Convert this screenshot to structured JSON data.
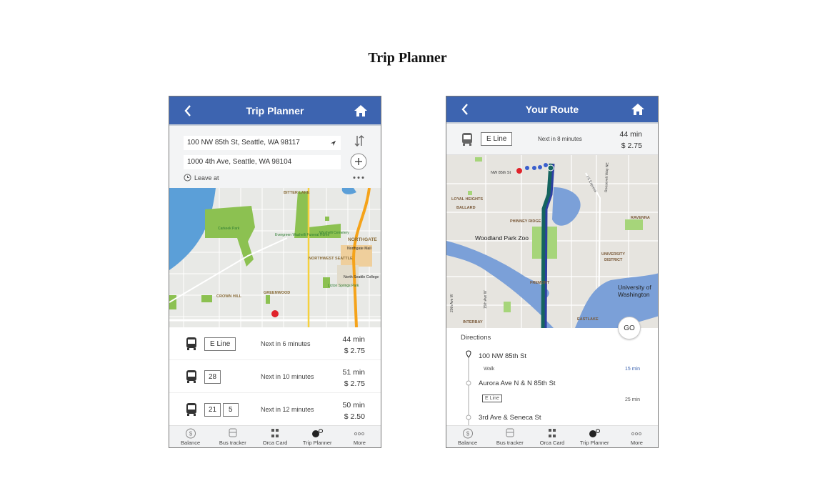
{
  "page_title": "Trip Planner",
  "colors": {
    "header": "#3d64b0",
    "route": "#15645f",
    "walk": "#3a5fcd",
    "origin_pin": "#e0232b"
  },
  "left": {
    "header": {
      "title": "Trip Planner",
      "back_icon": "chevron-left-icon",
      "home_icon": "home-icon"
    },
    "from": "100 NW 85th St, Seattle, WA 98117",
    "to": "1000 4th Ave, Seattle, WA 98104",
    "leave_at": "Leave at",
    "map_labels": [
      "BITTER LAKE",
      "Carkeek Park",
      "Evergreen Washelli Funeral Home",
      "Washelli Cemetery",
      "Northgate Mall",
      "NORTHGATE",
      "NORTHWEST SEATTLE",
      "North Seattle College",
      "Licton Springs Park",
      "GREENWOOD",
      "CROWN HILL"
    ],
    "results": [
      {
        "routes": [
          "E Line"
        ],
        "next": "Next in 6 minutes",
        "duration": "44 min",
        "fare": "$ 2.75"
      },
      {
        "routes": [
          "28"
        ],
        "next": "Next in 10 minutes",
        "duration": "51 min",
        "fare": "$ 2.75"
      },
      {
        "routes": [
          "21",
          "5"
        ],
        "next": "Next in 12 minutes",
        "duration": "50 min",
        "fare": "$ 2.50"
      }
    ]
  },
  "right": {
    "header": {
      "title": "Your Route"
    },
    "summary": {
      "route": "E Line",
      "next": "Next in 8 minutes",
      "duration": "44 min",
      "fare": "$ 2.75"
    },
    "map_labels": [
      "NW 85th St",
      "LOYAL HEIGHTS",
      "BALLARD",
      "PHINNEY RIDGE",
      "Woodland Park Zoo",
      "UNIVERSITY",
      "DISTRICT",
      "FREMONT",
      "University of",
      "Washington",
      "EASTLAKE",
      "INTERBAY",
      "RAVENNA",
      "I-5 Express",
      "Roosevelt Way NE",
      "15th Ave W",
      "20th Ave W"
    ],
    "go": "GO",
    "directions": {
      "title": "Directions",
      "stops": [
        "100 NW 85th St",
        "Aurora Ave N & N 85th St",
        "3rd Ave & Seneca St"
      ],
      "legs": [
        {
          "mode": "Walk",
          "time": "15 min"
        },
        {
          "mode": "E Line",
          "time": "25 min"
        }
      ]
    }
  },
  "tabs": [
    {
      "label": "Balance",
      "icon": "dollar-circle-icon"
    },
    {
      "label": "Bus tracker",
      "icon": "bus-icon"
    },
    {
      "label": "Orca Card",
      "icon": "qr-code-icon"
    },
    {
      "label": "Trip Planner",
      "icon": "map-pin-route-icon"
    },
    {
      "label": "More",
      "icon": "more-dots-icon"
    }
  ]
}
